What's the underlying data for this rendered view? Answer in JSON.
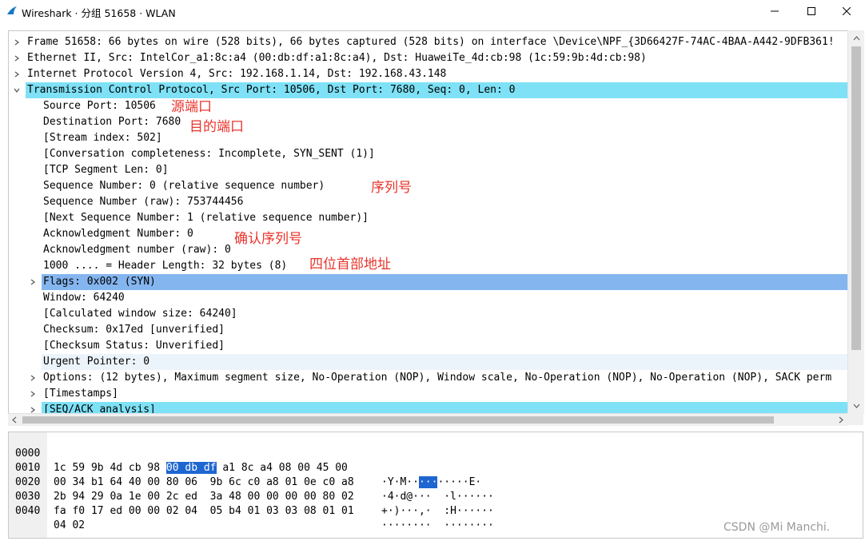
{
  "window": {
    "title": "Wireshark · 分组 51658 · WLAN"
  },
  "tree": [
    {
      "text": "Frame 51658: 66 bytes on wire (528 bits), 66 bytes captured (528 bits) on interface \\Device\\NPF_{3D66427F-74AC-4BAA-A442-9DFB361!"
    },
    {
      "text": "Ethernet II, Src: IntelCor_a1:8c:a4 (00:db:df:a1:8c:a4), Dst: HuaweiTe_4d:cb:98 (1c:59:9b:4d:cb:98)"
    },
    {
      "text": "Internet Protocol Version 4, Src: 192.168.1.14, Dst: 192.168.43.148"
    },
    {
      "text": "Transmission Control Protocol, Src Port: 10506, Dst Port: 7680, Seq: 0, Len: 0"
    },
    {
      "text": "Source Port: 10506"
    },
    {
      "text": "Destination Port: 7680"
    },
    {
      "text": "[Stream index: 502]"
    },
    {
      "text": "[Conversation completeness: Incomplete, SYN_SENT (1)]"
    },
    {
      "text": "[TCP Segment Len: 0]"
    },
    {
      "text": "Sequence Number: 0    (relative sequence number)"
    },
    {
      "text": "Sequence Number (raw): 753744456"
    },
    {
      "text": "[Next Sequence Number: 1    (relative sequence number)]"
    },
    {
      "text": "Acknowledgment Number: 0"
    },
    {
      "text": "Acknowledgment number (raw): 0"
    },
    {
      "text": "1000 .... = Header Length: 32 bytes (8)"
    },
    {
      "text": "Flags: 0x002 (SYN)"
    },
    {
      "text": "Window: 64240"
    },
    {
      "text": "[Calculated window size: 64240]"
    },
    {
      "text": "Checksum: 0x17ed [unverified]"
    },
    {
      "text": "[Checksum Status: Unverified]"
    },
    {
      "text": "Urgent Pointer: 0"
    },
    {
      "text": "Options: (12 bytes), Maximum segment size, No-Operation (NOP), Window scale, No-Operation (NOP), No-Operation (NOP), SACK perm"
    },
    {
      "text": "[Timestamps]"
    },
    {
      "text": "[SEQ/ACK analysis]"
    }
  ],
  "annotations": {
    "source_port": "源端口",
    "dest_port": "目的端口",
    "seq": "序列号",
    "ack": "确认序列号",
    "header_len": "四位首部地址"
  },
  "bytes": [
    {
      "offset": "0000",
      "hex_a": "1c 59 9b 4d cb 98 ",
      "hex_sel": "00 db df",
      "hex_b": " a1 8c a4 08 00 45 00",
      "ascii_a": "·Y·M··",
      "ascii_sel": "···",
      "ascii_b": "·····E·"
    },
    {
      "offset": "0010",
      "hex": "00 34 b1 64 40 00 80 06  9b 6c c0 a8 01 0e c0 a8",
      "ascii": "·4·d@···  ·l······"
    },
    {
      "offset": "0020",
      "hex": "2b 94 29 0a 1e 00 2c ed  3a 48 00 00 00 00 80 02",
      "ascii": "+·)···,·  :H······"
    },
    {
      "offset": "0030",
      "hex": "fa f0 17 ed 00 00 02 04  05 b4 01 03 03 08 01 01",
      "ascii": "········  ········"
    },
    {
      "offset": "0040",
      "hex": "04 02",
      "ascii": "··"
    }
  ],
  "watermark": "CSDN @Mi   Manchi.",
  "colors": {
    "cyan_highlight": "#7ee1f6",
    "blue_highlight": "#84b5ef",
    "annotation_red": "#e8342b",
    "byte_selection": "#1e66d0"
  },
  "icons": [
    "wireshark-fin-icon",
    "minimize-icon",
    "maximize-icon",
    "close-icon",
    "chevron-right-icon",
    "chevron-down-icon",
    "scroll-up-icon",
    "scroll-down-icon",
    "scroll-left-icon",
    "scroll-right-icon"
  ]
}
